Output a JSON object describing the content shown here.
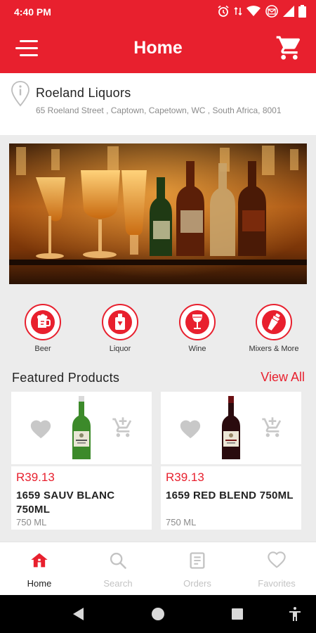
{
  "status": {
    "time": "4:40 PM"
  },
  "header": {
    "title": "Home",
    "menu_icon": "menu-icon",
    "cart_icon": "cart-icon"
  },
  "store": {
    "name": "Roeland Liquors",
    "address": "65 Roeland Street , Captown, Capetown, WC , South Africa, 8001"
  },
  "categories": [
    {
      "label": "Beer",
      "icon": "beer-icon"
    },
    {
      "label": "Liquor",
      "icon": "liquor-bottle-icon"
    },
    {
      "label": "Wine",
      "icon": "wine-glass-icon"
    },
    {
      "label": "Mixers & More",
      "icon": "shaker-icon"
    }
  ],
  "featured": {
    "title": "Featured Products",
    "view_all": "View All",
    "products": [
      {
        "price": "R39.13",
        "name": "1659 SAUV BLANC 750ML",
        "size": "750 ML"
      },
      {
        "price": "R39.13",
        "name": "1659 RED BLEND 750ML",
        "size": "750 ML"
      }
    ]
  },
  "nav": [
    {
      "label": "Home",
      "icon": "home-icon",
      "active": true
    },
    {
      "label": "Search",
      "icon": "search-icon",
      "active": false
    },
    {
      "label": "Orders",
      "icon": "orders-icon",
      "active": false
    },
    {
      "label": "Favorites",
      "icon": "heart-icon",
      "active": false
    }
  ],
  "colors": {
    "brand": "#e8202e",
    "muted": "#c3c3c3"
  }
}
